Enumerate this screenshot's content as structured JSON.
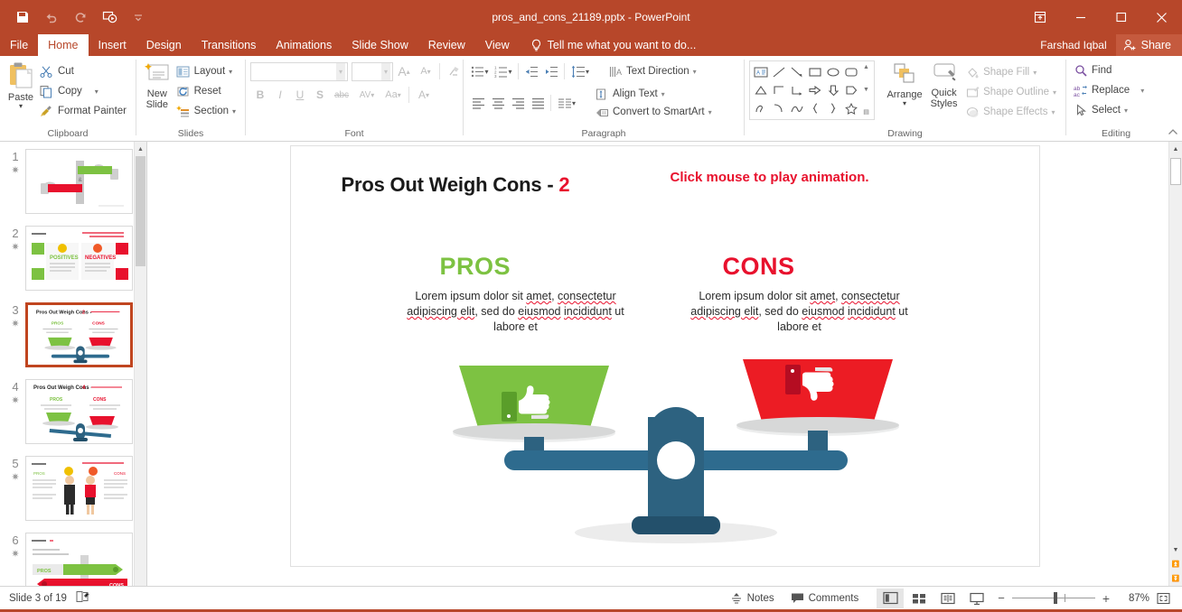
{
  "titlebar": {
    "filename": "pros_and_cons_21189.pptx - PowerPoint",
    "qat": [
      {
        "name": "save",
        "icon": "save-icon"
      },
      {
        "name": "undo",
        "icon": "undo-icon"
      },
      {
        "name": "redo",
        "icon": "redo-icon"
      },
      {
        "name": "start-presentation",
        "icon": "presentation-icon"
      },
      {
        "name": "customize-qat",
        "icon": "chevron-down-icon"
      }
    ],
    "window": {
      "restore": "restore-icon",
      "minimize": "minimize-icon",
      "maximize": "maximize-icon",
      "close": "close-icon"
    }
  },
  "tabs": [
    {
      "label": "File",
      "active": false
    },
    {
      "label": "Home",
      "active": true
    },
    {
      "label": "Insert",
      "active": false
    },
    {
      "label": "Design",
      "active": false
    },
    {
      "label": "Transitions",
      "active": false
    },
    {
      "label": "Animations",
      "active": false
    },
    {
      "label": "Slide Show",
      "active": false
    },
    {
      "label": "Review",
      "active": false
    },
    {
      "label": "View",
      "active": false
    }
  ],
  "tellme": {
    "label": "Tell me what you want to do...",
    "icon": "lightbulb-icon"
  },
  "account": {
    "user": "Farshad Iqbal",
    "share_label": "Share",
    "share_icon": "person-add-icon"
  },
  "ribbon": {
    "groups": [
      {
        "name": "Clipboard",
        "paste": {
          "label": "Paste",
          "icon": "clipboard-icon"
        },
        "items": [
          {
            "label": "Cut",
            "icon": "scissors-icon"
          },
          {
            "label": "Copy",
            "icon": "copy-icon"
          },
          {
            "label": "Format Painter",
            "icon": "paintbrush-icon"
          }
        ]
      },
      {
        "name": "Slides",
        "newslide": {
          "label1": "New",
          "label2": "Slide",
          "icon": "new-slide-icon"
        },
        "items": [
          {
            "label": "Layout",
            "icon": "layout-icon"
          },
          {
            "label": "Reset",
            "icon": "reset-icon"
          },
          {
            "label": "Section",
            "icon": "section-icon"
          }
        ]
      },
      {
        "name": "Font",
        "font_name_value": "",
        "font_size_value": "",
        "grow": "A",
        "shrink": "A",
        "clear_format": "clear-formatting-icon",
        "buttons": [
          "B",
          "I",
          "U",
          "S",
          "abc",
          "AV",
          "Aa",
          "A"
        ]
      },
      {
        "name": "Paragraph",
        "items": [
          {
            "label": "Text Direction",
            "icon": "text-direction-icon"
          },
          {
            "label": "Align Text",
            "icon": "align-text-icon"
          },
          {
            "label": "Convert to SmartArt",
            "icon": "smartart-icon"
          }
        ]
      },
      {
        "name": "Drawing",
        "arrange": {
          "label": "Arrange",
          "icon": "arrange-icon"
        },
        "quickstyles": {
          "label1": "Quick",
          "label2": "Styles",
          "icon": "quick-styles-icon"
        },
        "items": [
          {
            "label": "Shape Fill",
            "icon": "paint-bucket-icon"
          },
          {
            "label": "Shape Outline",
            "icon": "pen-outline-icon"
          },
          {
            "label": "Shape Effects",
            "icon": "shape-effects-icon"
          }
        ]
      },
      {
        "name": "Editing",
        "items": [
          {
            "label": "Find",
            "icon": "magnifier-icon"
          },
          {
            "label": "Replace",
            "icon": "replace-icon"
          },
          {
            "label": "Select",
            "icon": "cursor-icon"
          }
        ]
      }
    ]
  },
  "thumbnails": [
    {
      "number": "1",
      "star": "✷"
    },
    {
      "number": "2",
      "star": "✷"
    },
    {
      "number": "3",
      "star": "✷",
      "selected": true
    },
    {
      "number": "4",
      "star": "✷"
    },
    {
      "number": "5",
      "star": "✷"
    },
    {
      "number": "6",
      "star": "✷"
    }
  ],
  "slide": {
    "title_main": "Pros Out Weigh Cons - ",
    "title_number": "2",
    "animation_note": "Click mouse to play animation.",
    "pros": {
      "heading": "PROS",
      "line1_a": "Lorem ipsum dolor sit ",
      "line1_b": "amet",
      "line1_c": ", ",
      "line1_d": "consectetur",
      "line2_a": "adipiscing elit",
      "line2_b": ", sed do ",
      "line2_c": "eiusmod",
      "line3_a": "incididunt",
      "line3_b": " ut labore et",
      "thumb_icon": "thumbs-up-icon",
      "color": "#7dc242"
    },
    "cons": {
      "heading": "CONS",
      "line1_a": "Lorem ipsum dolor sit ",
      "line1_b": "amet",
      "line1_c": ", ",
      "line1_d": "consectetur",
      "line2_a": "adipiscing elit",
      "line2_b": ", sed do ",
      "line2_c": "eiusmod",
      "line3_a": "incididunt",
      "line3_b": " ut labore et",
      "thumb_icon": "thumbs-down-icon",
      "color": "#e8112d"
    },
    "scale": {
      "beam_color": "#2e6b8e",
      "post_color": "#2d6280",
      "base_color": "#23506b"
    }
  },
  "statusbar": {
    "slide_indicator": "Slide 3 of 19",
    "notes_page_icon": "notes-page-icon",
    "notes": {
      "label": "Notes",
      "icon": "notes-icon"
    },
    "comments": {
      "label": "Comments",
      "icon": "comments-icon"
    },
    "views": [
      {
        "name": "normal-view",
        "icon": "normal-view-icon",
        "active": true
      },
      {
        "name": "slide-sorter-view",
        "icon": "slide-sorter-icon",
        "active": false
      },
      {
        "name": "reading-view",
        "icon": "reading-view-icon",
        "active": false
      },
      {
        "name": "slide-show-view",
        "icon": "slide-show-icon",
        "active": false
      }
    ],
    "zoom_out": "−",
    "zoom_in": "+",
    "zoom_level": "87%",
    "fit_icon": "fit-slide-icon"
  }
}
